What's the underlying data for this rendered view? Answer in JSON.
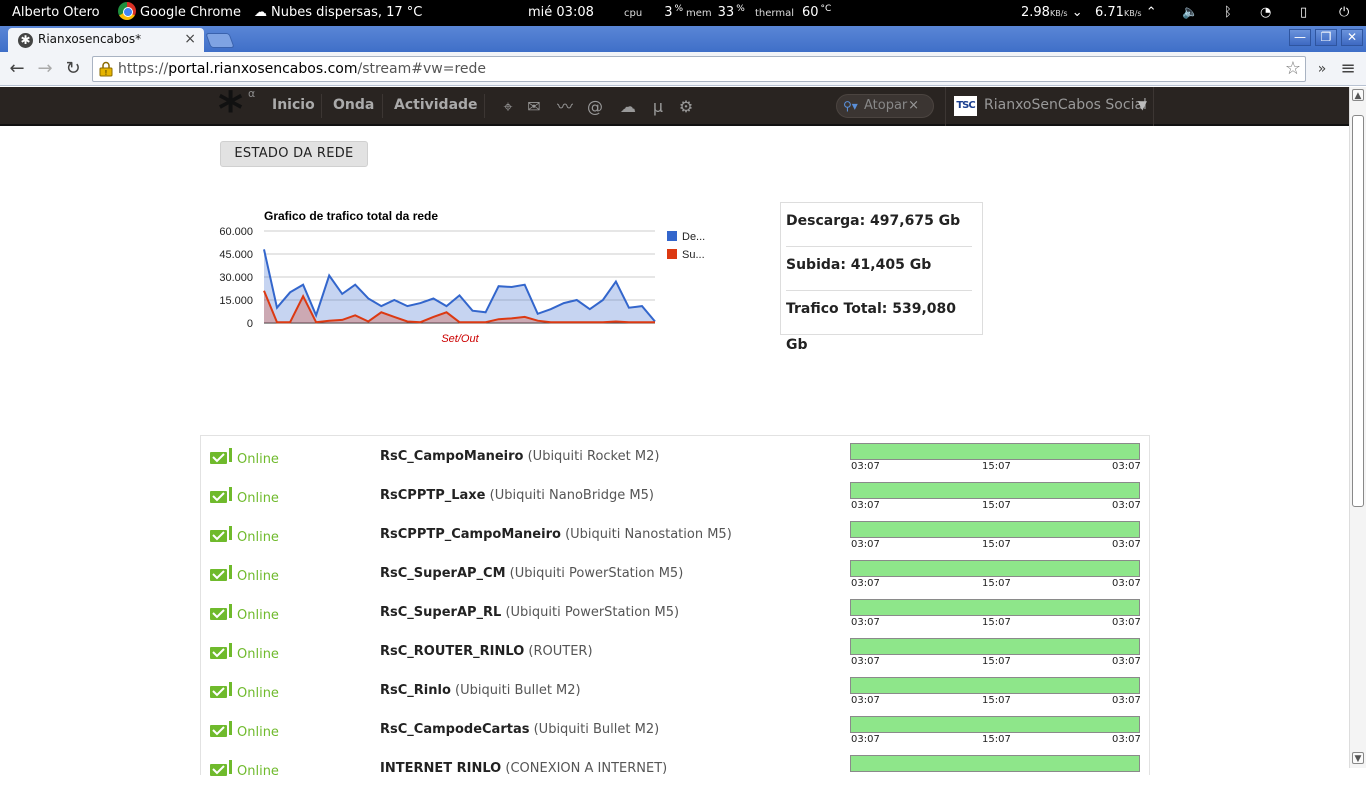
{
  "system_bar": {
    "user": "Alberto Otero",
    "app": "Google Chrome",
    "weather": "Nubes dispersas, 17 °C",
    "clock": "mié 03:08",
    "cpu_label": "cpu",
    "cpu_value": "3",
    "mem_label": "mem",
    "mem_value": "33",
    "percent_sign": "%",
    "thermal_label": "thermal",
    "thermal_value": "60",
    "thermal_unit": "°C",
    "net_down": "2.98",
    "net_up": "6.71",
    "net_unit": "KB/s"
  },
  "browser": {
    "tab_title": "Rianxosencabos*",
    "url_scheme": "https://",
    "url_host": "portal.rianxosencabos.com",
    "url_path": "/stream#vw=rede"
  },
  "site_nav": {
    "logo_sup": "α",
    "links": [
      "Inicio",
      "Onda",
      "Actividade"
    ],
    "search_placeholder": "Atopar",
    "user_name": "RianxoSenCabos Social",
    "user_avatar": "TSC"
  },
  "page": {
    "section_button": "ESTADO DA REDE"
  },
  "stats": {
    "download": "Descarga: 497,675 Gb",
    "upload": "Subida: 41,405 Gb",
    "total": "Trafico Total: 539,080 Gb"
  },
  "chart_data": {
    "type": "area",
    "title": "Grafico de trafico total da rede",
    "xlabel": "Set/Out",
    "ylabel": "",
    "ylim": [
      0,
      60000
    ],
    "yticks": [
      "60.000",
      "45.000",
      "30.000",
      "15.000",
      "0"
    ],
    "series": [
      {
        "name": "De...",
        "color": "#3366cc",
        "values": [
          48000,
          10000,
          20000,
          25000,
          5000,
          31000,
          19000,
          25000,
          16000,
          11000,
          15000,
          11000,
          13000,
          16000,
          11000,
          18000,
          8000,
          7000,
          24000,
          23500,
          25000,
          6000,
          9000,
          13000,
          15000,
          9000,
          15000,
          27000,
          10000,
          11000,
          1000
        ]
      },
      {
        "name": "Su...",
        "color": "#dc3912",
        "values": [
          21000,
          500,
          500,
          17500,
          500,
          1500,
          2000,
          5000,
          1000,
          7000,
          4000,
          1000,
          500,
          4000,
          7000,
          500,
          500,
          500,
          2500,
          3000,
          4000,
          1500,
          500,
          500,
          500,
          500,
          500,
          1000,
          500,
          500,
          500
        ]
      }
    ],
    "legend": "right"
  },
  "devices": [
    {
      "status": "Online",
      "name": "RsC_CampoManeiro",
      "model": "(Ubiquiti Rocket M2)",
      "t_start": "03:07",
      "t_mid": "15:07",
      "t_end": "03:07"
    },
    {
      "status": "Online",
      "name": "RsCPPTP_Laxe",
      "model": "(Ubiquiti NanoBridge M5)",
      "t_start": "03:07",
      "t_mid": "15:07",
      "t_end": "03:07"
    },
    {
      "status": "Online",
      "name": "RsCPPTP_CampoManeiro",
      "model": "(Ubiquiti Nanostation M5)",
      "t_start": "03:07",
      "t_mid": "15:07",
      "t_end": "03:07"
    },
    {
      "status": "Online",
      "name": "RsC_SuperAP_CM",
      "model": "(Ubiquiti PowerStation M5)",
      "t_start": "03:07",
      "t_mid": "15:07",
      "t_end": "03:07"
    },
    {
      "status": "Online",
      "name": "RsC_SuperAP_RL",
      "model": "(Ubiquiti PowerStation M5)",
      "t_start": "03:07",
      "t_mid": "15:07",
      "t_end": "03:07"
    },
    {
      "status": "Online",
      "name": "RsC_ROUTER_RINLO",
      "model": "(ROUTER)",
      "t_start": "03:07",
      "t_mid": "15:07",
      "t_end": "03:07"
    },
    {
      "status": "Online",
      "name": "RsC_Rinlo",
      "model": "(Ubiquiti Bullet M2)",
      "t_start": "03:07",
      "t_mid": "15:07",
      "t_end": "03:07"
    },
    {
      "status": "Online",
      "name": "RsC_CampodeCartas",
      "model": "(Ubiquiti Bullet M2)",
      "t_start": "03:07",
      "t_mid": "15:07",
      "t_end": "03:07"
    },
    {
      "status": "Online",
      "name": "INTERNET RINLO",
      "model": "(CONEXION A INTERNET)",
      "t_start": "",
      "t_mid": "",
      "t_end": ""
    }
  ],
  "colors": {
    "online_green": "#6fba2c",
    "uptime_bar": "#8ee68a",
    "nav_bg": "#292421",
    "tabstrip_blue": "#4f7dd0"
  }
}
